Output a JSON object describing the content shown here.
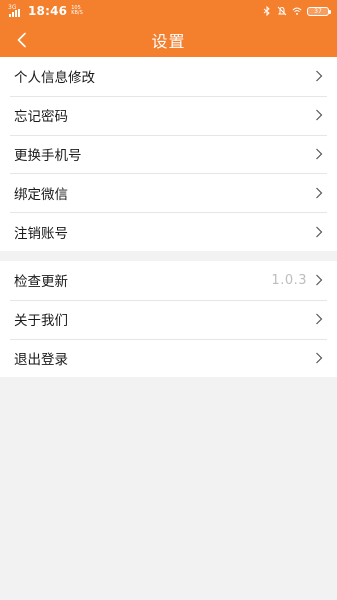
{
  "status_bar": {
    "network_type": "3G",
    "time": "18:46",
    "speed_value": "105",
    "speed_unit": "KB/S",
    "battery": "37",
    "icons": [
      "bluetooth-icon",
      "mute-icon",
      "wifi-icon",
      "battery-icon"
    ]
  },
  "header": {
    "title": "设置",
    "back_icon": "chevron-left-icon"
  },
  "settings_group_1": {
    "items": [
      {
        "label": "个人信息修改"
      },
      {
        "label": "忘记密码"
      },
      {
        "label": "更换手机号"
      },
      {
        "label": "绑定微信"
      },
      {
        "label": "注销账号"
      }
    ]
  },
  "settings_group_2": {
    "items": [
      {
        "label": "检查更新",
        "value": "1.0.3"
      },
      {
        "label": "关于我们"
      },
      {
        "label": "退出登录"
      }
    ]
  },
  "colors": {
    "accent": "#f47f2c",
    "background": "#f2f2f2",
    "divider": "#e6e6e6",
    "value_text": "#bdbdbd"
  }
}
